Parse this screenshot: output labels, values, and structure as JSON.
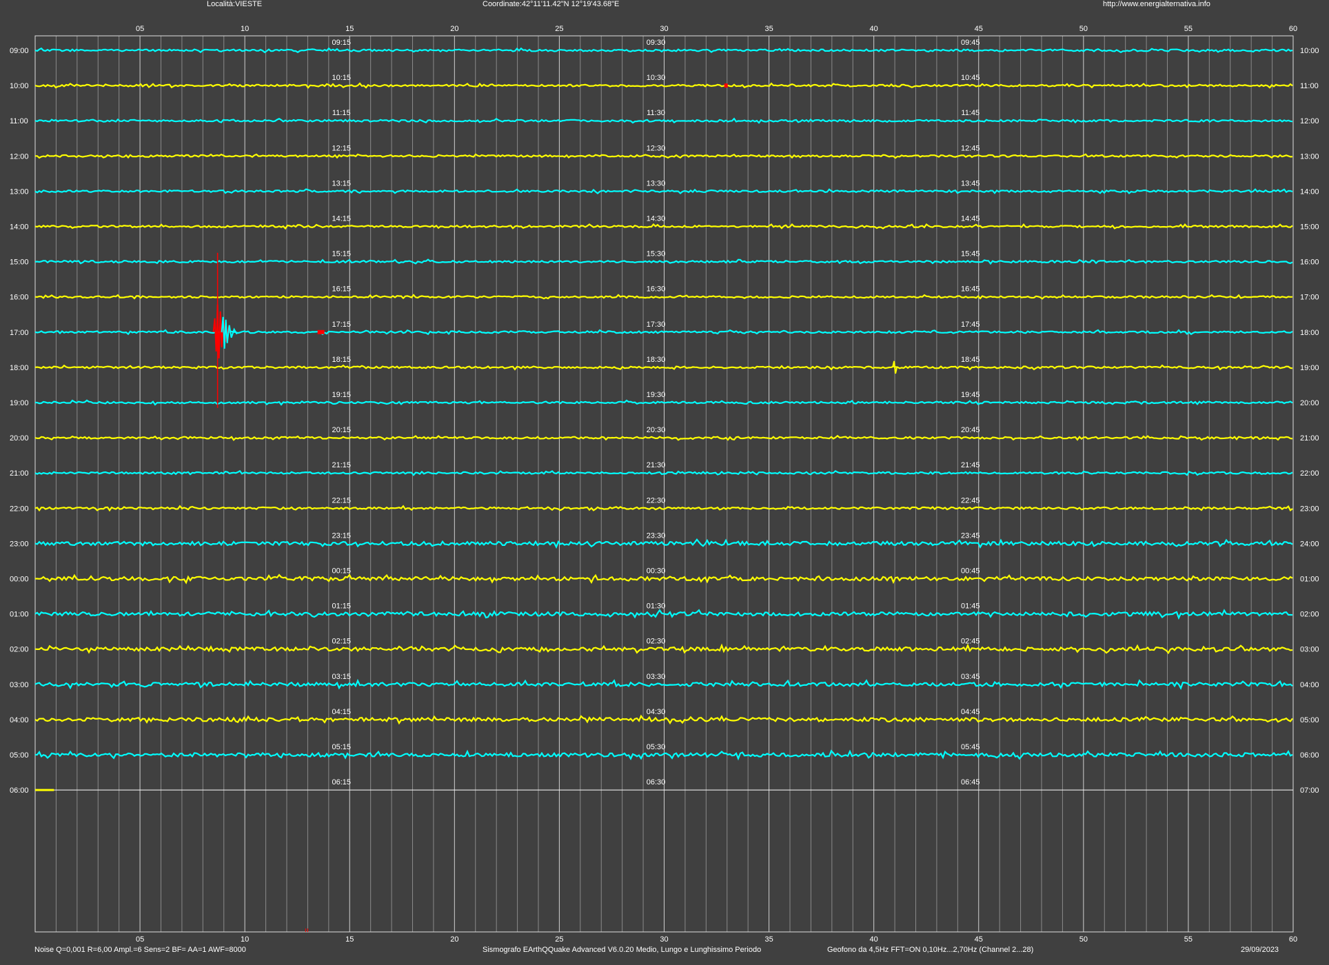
{
  "header": {
    "location": "Località:VIESTE",
    "coordinates": "Coordinate:42°11'11.42\"N  12°19'43.68\"E",
    "website": "http://www.energialternativa.info"
  },
  "footer": {
    "settings": "Noise Q=0,001 R=6,00 Ampl.=6 Sens=2 BF= AA=1 AWF=8000",
    "software": "Sismografo  EArthQQuake Advanced V6.0.20  Medio, Lungo e Lunghissimo Periodo",
    "sensor": "Geofono da 4,5Hz FFT=ON 0,10Hz...2,70Hz      (Channel 2...28)",
    "date": "29/09/2023"
  },
  "colors": {
    "background": "#404040",
    "trace_a": "#00ffff",
    "trace_b": "#ffff00",
    "event": "#ff0000",
    "grid_major": "#d0d0d0",
    "grid_minor": "#8a8a8a"
  },
  "x_axis": {
    "minutes_labels": [
      "05",
      "10",
      "15",
      "20",
      "25",
      "30",
      "35",
      "40",
      "45",
      "50",
      "55",
      "60"
    ]
  },
  "rows": [
    {
      "left": "09:00",
      "right": "10:00",
      "marks": [
        "09:15",
        "09:30",
        "09:45"
      ]
    },
    {
      "left": "10:00",
      "right": "11:00",
      "marks": [
        "10:15",
        "10:30",
        "10:45"
      ]
    },
    {
      "left": "11:00",
      "right": "12:00",
      "marks": [
        "11:15",
        "11:30",
        "11:45"
      ]
    },
    {
      "left": "12:00",
      "right": "13:00",
      "marks": [
        "12:15",
        "12:30",
        "12:45"
      ]
    },
    {
      "left": "13:00",
      "right": "14:00",
      "marks": [
        "13:15",
        "13:30",
        "13:45"
      ]
    },
    {
      "left": "14:00",
      "right": "15:00",
      "marks": [
        "14:15",
        "14:30",
        "14:45"
      ]
    },
    {
      "left": "15:00",
      "right": "16:00",
      "marks": [
        "15:15",
        "15:30",
        "15:45"
      ]
    },
    {
      "left": "16:00",
      "right": "17:00",
      "marks": [
        "16:15",
        "16:30",
        "16:45"
      ]
    },
    {
      "left": "17:00",
      "right": "18:00",
      "marks": [
        "17:15",
        "17:30",
        "17:45"
      ]
    },
    {
      "left": "18:00",
      "right": "19:00",
      "marks": [
        "18:15",
        "18:30",
        "18:45"
      ]
    },
    {
      "left": "19:00",
      "right": "20:00",
      "marks": [
        "19:15",
        "19:30",
        "19:45"
      ]
    },
    {
      "left": "20:00",
      "right": "21:00",
      "marks": [
        "20:15",
        "20:30",
        "20:45"
      ]
    },
    {
      "left": "21:00",
      "right": "22:00",
      "marks": [
        "21:15",
        "21:30",
        "21:45"
      ]
    },
    {
      "left": "22:00",
      "right": "23:00",
      "marks": [
        "22:15",
        "22:30",
        "22:45"
      ]
    },
    {
      "left": "23:00",
      "right": "24:00",
      "marks": [
        "23:15",
        "23:30",
        "23:45"
      ]
    },
    {
      "left": "00:00",
      "right": "01:00",
      "marks": [
        "00:15",
        "00:30",
        "00:45"
      ]
    },
    {
      "left": "01:00",
      "right": "02:00",
      "marks": [
        "01:15",
        "01:30",
        "01:45"
      ]
    },
    {
      "left": "02:00",
      "right": "03:00",
      "marks": [
        "02:15",
        "02:30",
        "02:45"
      ]
    },
    {
      "left": "03:00",
      "right": "04:00",
      "marks": [
        "03:15",
        "03:30",
        "03:45"
      ]
    },
    {
      "left": "04:00",
      "right": "05:00",
      "marks": [
        "04:15",
        "04:30",
        "04:45"
      ]
    },
    {
      "left": "05:00",
      "right": "06:00",
      "marks": [
        "05:15",
        "05:30",
        "05:45"
      ]
    },
    {
      "left": "06:00",
      "right": "07:00",
      "marks": [
        "06:15",
        "06:30",
        "06:45"
      ]
    }
  ],
  "events": [
    {
      "row": 8,
      "minute": 8.7,
      "note": "large seismic event, 17:08"
    },
    {
      "row": 8,
      "minute": 13.6,
      "note": "red marker"
    },
    {
      "row": 1,
      "minute": 33.0,
      "note": "red marker"
    }
  ],
  "trace_end_minute_last_row": 0.9
}
